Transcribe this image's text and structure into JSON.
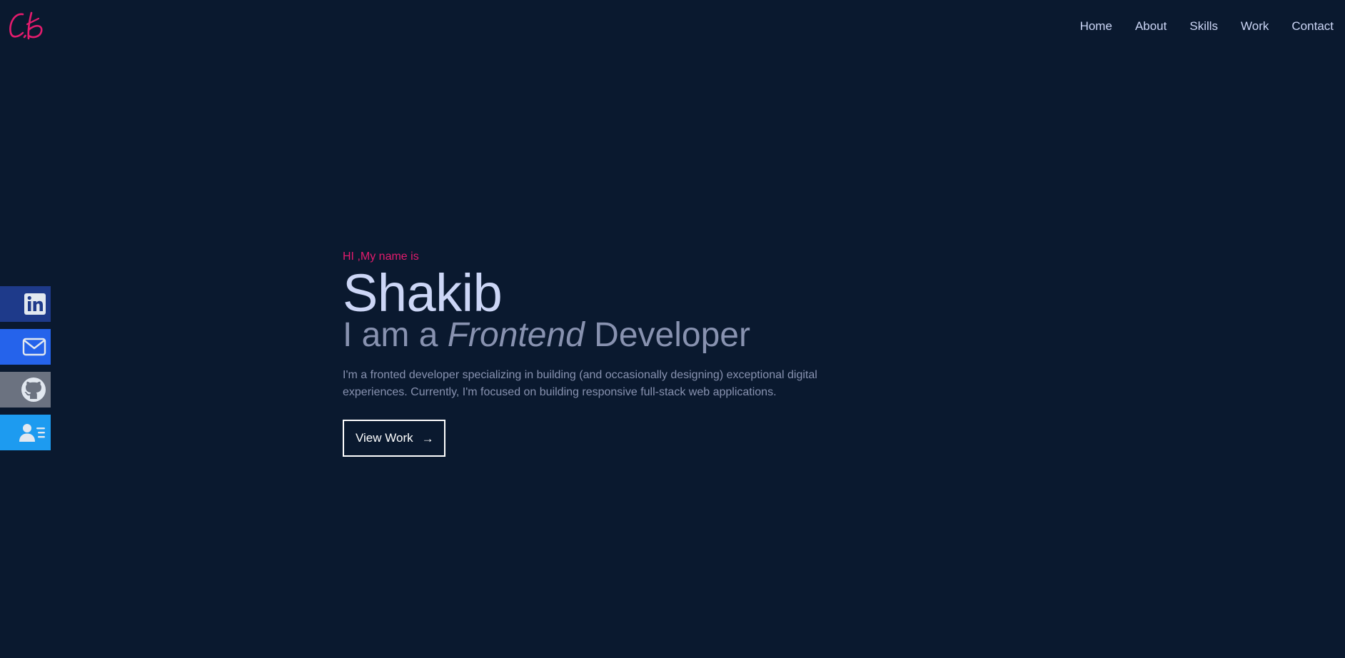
{
  "nav": {
    "items": [
      {
        "label": "Home"
      },
      {
        "label": "About"
      },
      {
        "label": "Skills"
      },
      {
        "label": "Work"
      },
      {
        "label": "Contact"
      }
    ]
  },
  "social": [
    {
      "name": "linkedin-icon",
      "color": "#1e3a8a"
    },
    {
      "name": "mail-icon",
      "color": "#2563eb"
    },
    {
      "name": "github-icon",
      "color": "#6b7280"
    },
    {
      "name": "resume-icon",
      "color": "#1d9bf0"
    }
  ],
  "hero": {
    "intro": "HI ,My name is",
    "name": "Shakib",
    "role_prefix": "I am a ",
    "role_emphasis": "Frontend",
    "role_suffix": " Developer",
    "description": "I'm a fronted developer specializing in building (and occasionally designing) exceptional digital experiences. Currently, I'm focused on building responsive full-stack web applications.",
    "button_label": "View Work",
    "button_arrow": "→"
  },
  "colors": {
    "background": "#0a192f",
    "accent": "#e31b6d",
    "heading": "#ccd6f6",
    "muted": "#8892b0"
  }
}
